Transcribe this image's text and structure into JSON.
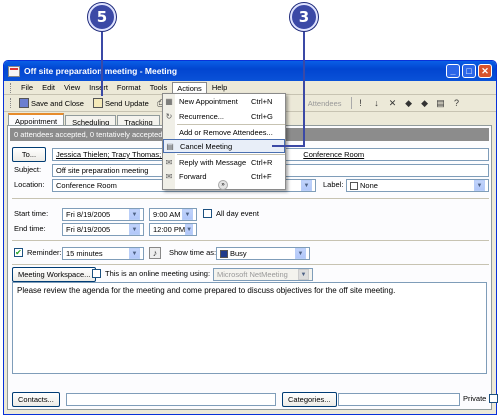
{
  "callouts": {
    "c5": "5",
    "c3": "3"
  },
  "window": {
    "title": "Off site preparation meeting - Meeting"
  },
  "menu": [
    "File",
    "Edit",
    "View",
    "Insert",
    "Format",
    "Tools",
    "Actions",
    "Help"
  ],
  "toolbar": {
    "save_close": "Save and Close",
    "send_update": "Send Update",
    "attendees": "Attendees"
  },
  "tabs": [
    "Appointment",
    "Scheduling",
    "Tracking"
  ],
  "infobar": "0 attendees accepted, 0 tentatively accepted, 0",
  "form": {
    "to_button": "To...",
    "to_value": "Jessica Thielen; Tracy Thomas; Ga",
    "to_tail": "Conference Room",
    "subject_label": "Subject:",
    "subject_value": "Off site preparation meeting",
    "location_label": "Location:",
    "location_value": "Conference Room",
    "label_label": "Label:",
    "label_value": "None",
    "start_label": "Start time:",
    "start_date": "Fri 8/19/2005",
    "start_time": "9:00 AM",
    "all_day": "All day event",
    "end_label": "End time:",
    "end_date": "Fri 8/19/2005",
    "end_time": "12:00 PM",
    "reminder_label": "Reminder:",
    "reminder_value": "15 minutes",
    "show_time_label": "Show time as:",
    "show_time_value": "Busy",
    "workspace_button": "Meeting Workspace...",
    "online_label": "This is an online meeting using:",
    "online_value": "Microsoft NetMeeting",
    "body": "Please review the agenda for the meeting and come prepared to discuss objectives for the off site meeting.",
    "contacts_button": "Contacts...",
    "categories_button": "Categories...",
    "private_label": "Private"
  },
  "actions_menu": [
    {
      "label": "New Appointment",
      "shortcut": "Ctrl+N"
    },
    {
      "label": "Recurrence...",
      "shortcut": "Ctrl+G"
    },
    {
      "label": "Add or Remove Attendees...",
      "shortcut": ""
    },
    {
      "label": "Cancel Meeting",
      "shortcut": ""
    },
    {
      "label": "Reply with Message",
      "shortcut": "Ctrl+R"
    },
    {
      "label": "Forward",
      "shortcut": "Ctrl+F"
    }
  ],
  "colors": {
    "callout": "#3b49a6",
    "titlebar": "#0245d0",
    "infobar": "#8c8c8c"
  }
}
